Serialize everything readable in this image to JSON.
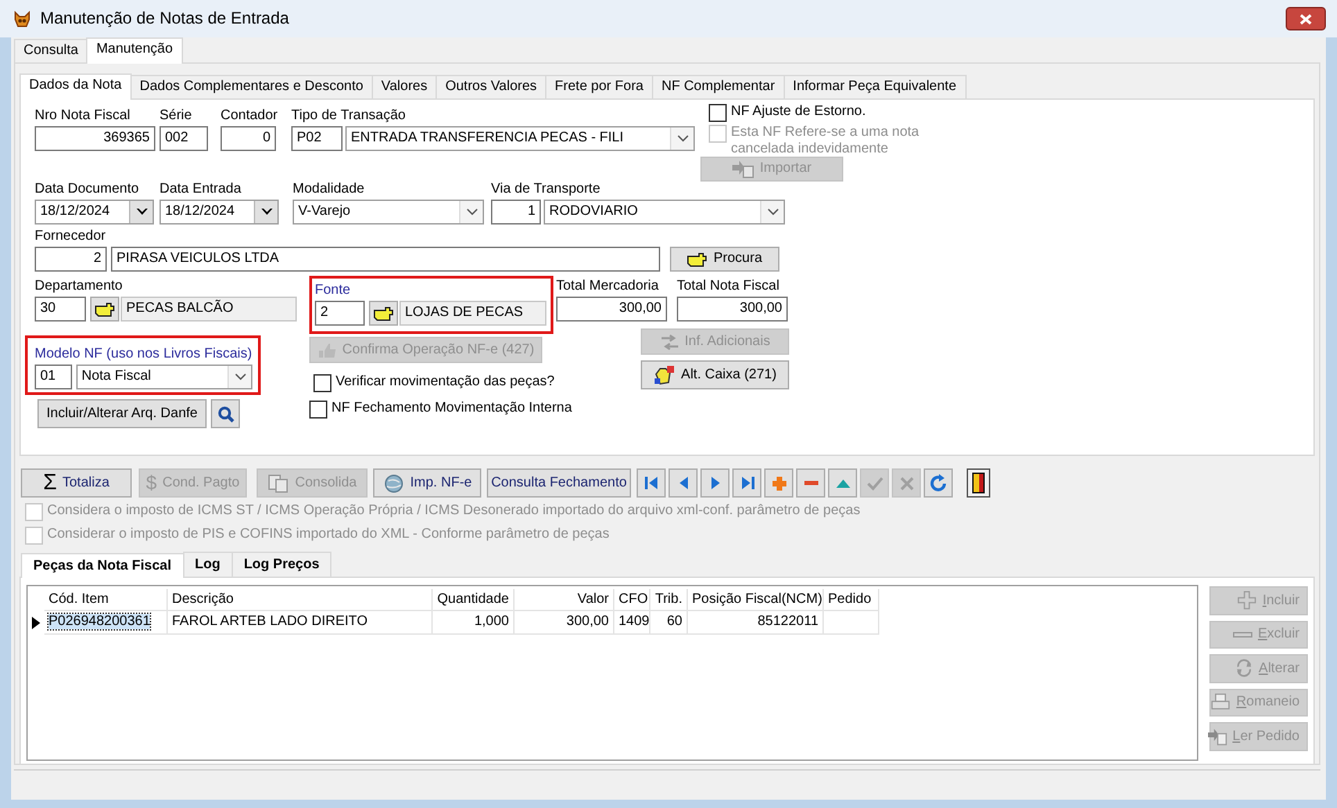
{
  "window": {
    "title": "Manutenção de Notas de Entrada"
  },
  "main_tabs": [
    {
      "label": "Consulta",
      "selected": false
    },
    {
      "label": "Manutenção",
      "selected": true
    }
  ],
  "nota_tabs": [
    {
      "label": "Dados da Nota",
      "selected": true
    },
    {
      "label": "Dados Complementares e Desconto",
      "selected": false
    },
    {
      "label": "Valores",
      "selected": false
    },
    {
      "label": "Outros Valores",
      "selected": false
    },
    {
      "label": "Frete por Fora",
      "selected": false
    },
    {
      "label": "NF Complementar",
      "selected": false
    },
    {
      "label": "Informar Peça Equivalente",
      "selected": false
    }
  ],
  "nro_nota_fiscal": {
    "label": "Nro Nota Fiscal",
    "value": "369365"
  },
  "serie": {
    "label": "Série",
    "value": "002"
  },
  "contador": {
    "label": "Contador",
    "value": "0"
  },
  "tipo_transacao": {
    "label": "Tipo de Transação",
    "code": "P02",
    "value": "ENTRADA TRANSFERENCIA PECAS - FILI"
  },
  "nf_ajuste": {
    "label": "NF Ajuste  de Estorno.",
    "checked": false,
    "disabled": false
  },
  "nf_cancelada": {
    "label": "Esta NF Refere-se a uma nota cancelada indevidamente",
    "checked": false,
    "disabled": true
  },
  "importar_button": {
    "label": "Importar",
    "disabled": true
  },
  "data_documento": {
    "label": "Data Documento",
    "value": "18/12/2024"
  },
  "data_entrada": {
    "label": "Data Entrada",
    "value": "18/12/2024"
  },
  "modalidade": {
    "label": "Modalidade",
    "value": "V-Varejo"
  },
  "via_transporte": {
    "label": "Via de Transporte",
    "code": "1",
    "value": "RODOVIARIO"
  },
  "fornecedor": {
    "label": "Fornecedor",
    "code": "2",
    "value": "PIRASA VEICULOS LTDA"
  },
  "procura_button": {
    "label": "Procura",
    "disabled": false
  },
  "departamento": {
    "label": "Departamento",
    "code": "30",
    "value": "PECAS BALCÃO",
    "highlighted": false
  },
  "fonte": {
    "label": "Fonte",
    "code": "2",
    "value": "LOJAS DE PECAS",
    "highlighted": true
  },
  "total_mercadoria": {
    "label": "Total Mercadoria",
    "value": "300,00"
  },
  "total_nota_fiscal": {
    "label": "Total Nota Fiscal",
    "value": "300,00"
  },
  "modelo_nf": {
    "label": "Modelo NF (uso nos Livros Fiscais)",
    "code": "01",
    "value": "Nota Fiscal",
    "highlighted": true
  },
  "confirma_button": {
    "label": "Confirma Operação NF-e (427)",
    "disabled": true
  },
  "inf_adicionais_button": {
    "label": "Inf. Adicionais",
    "disabled": true
  },
  "alt_caixa_button": {
    "label": "Alt. Caixa (271)",
    "disabled": false
  },
  "verificar_check": {
    "label": "Verificar movimentação das peças?",
    "checked": false,
    "disabled": false
  },
  "fechamento_check": {
    "label": "NF Fechamento Movimentação Interna",
    "checked": false,
    "disabled": false
  },
  "danfe_button": {
    "label": "Incluir/Alterar Arq. Danfe",
    "disabled": false
  },
  "toolbar_buttons": [
    {
      "kind": "sigma",
      "symbol": "Σ",
      "label": "Totaliza",
      "disabled": false
    },
    {
      "kind": "dollar",
      "symbol": "$",
      "label": "Cond. Pagto",
      "disabled": true
    },
    {
      "kind": "docs",
      "label": "Consolida",
      "disabled": true
    },
    {
      "kind": "globe",
      "label": "Imp.  NF-e",
      "disabled": false
    },
    {
      "kind": "plain",
      "label": "Consulta Fechamento",
      "disabled": false
    }
  ],
  "navigator": [
    {
      "kind": "first",
      "disabled": false
    },
    {
      "kind": "prior",
      "disabled": false
    },
    {
      "kind": "next",
      "disabled": false
    },
    {
      "kind": "last",
      "disabled": false
    },
    {
      "kind": "insert",
      "disabled": false
    },
    {
      "kind": "delete",
      "disabled": false
    },
    {
      "kind": "edit",
      "disabled": false
    },
    {
      "kind": "post",
      "disabled": true
    },
    {
      "kind": "cancel",
      "disabled": true
    },
    {
      "kind": "refresh",
      "disabled": false
    }
  ],
  "import_options": [
    {
      "label": "Considera o imposto de ICMS ST / ICMS Operação Própria / ICMS Desonerado importado do arquivo xml-conf. parâmetro de peças",
      "checked": false,
      "disabled": true
    },
    {
      "label": "Considerar o imposto de PIS e COFINS importado do XML - Conforme parâmetro de peças",
      "checked": false,
      "disabled": true
    }
  ],
  "grid_tabs": [
    {
      "label": "Peças da Nota Fiscal",
      "selected": true
    },
    {
      "label": "Log",
      "selected": false
    },
    {
      "label": "Log Preços",
      "selected": false
    }
  ],
  "table": {
    "columns": [
      "Cód. Item",
      "Descrição",
      "Quantidade",
      "Valor",
      "CFO",
      "Trib.",
      "Posição Fiscal(NCM)",
      "Pedido"
    ],
    "rows": [
      {
        "selected": true,
        "cells": [
          "P026948200361",
          "FAROL ARTEB LADO DIREITO",
          "1,000",
          "300,00",
          "1409",
          "60",
          "85122011"
        ]
      }
    ]
  },
  "side_buttons": [
    {
      "kind": "plus",
      "label": "Incluir",
      "disabled": true
    },
    {
      "kind": "minus",
      "label": "Excluir",
      "disabled": true
    },
    {
      "kind": "refresh",
      "label": "Alterar",
      "disabled": true
    },
    {
      "kind": "printer",
      "label": "Romaneio",
      "disabled": true
    },
    {
      "kind": "import",
      "label": "Ler Pedido",
      "disabled": true
    }
  ]
}
